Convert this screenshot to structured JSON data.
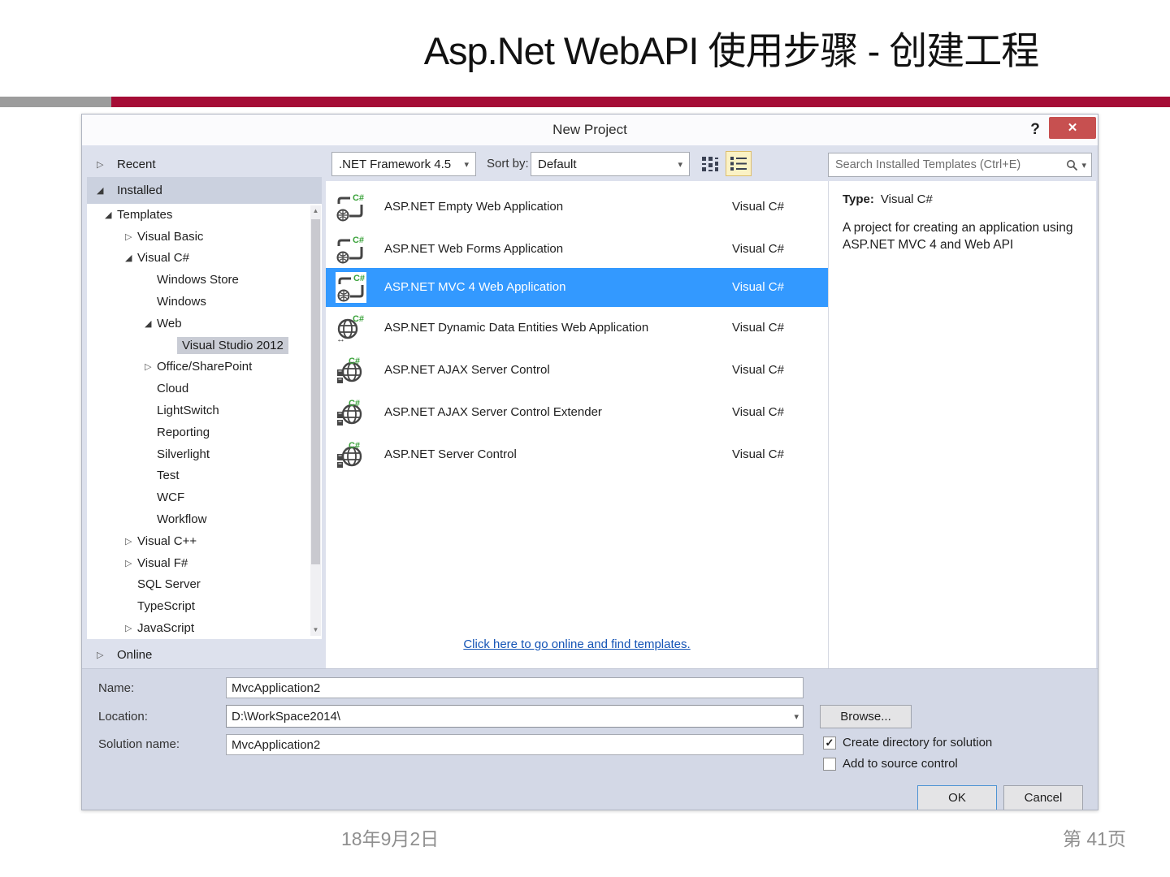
{
  "slide": {
    "title": "Asp.Net WebAPI 使用步骤 - 创建工程",
    "footer_date": "18年9月2日",
    "footer_page": "第 41页"
  },
  "dialog": {
    "title": "New Project",
    "help_label": "?",
    "close_glyph": "✕",
    "toolbar": {
      "framework_value": ".NET Framework 4.5",
      "sort_by_label": "Sort by:",
      "sort_value": "Default"
    },
    "search": {
      "placeholder": "Search Installed Templates (Ctrl+E)"
    },
    "nav": {
      "recent_label": "Recent",
      "installed_label": "Installed",
      "online_label": "Online",
      "tree": [
        {
          "label": "Templates",
          "state": "expanded"
        },
        {
          "label": "Visual Basic",
          "state": "collapsed"
        },
        {
          "label": "Visual C#",
          "state": "expanded"
        },
        {
          "label": "Windows Store",
          "state": "none"
        },
        {
          "label": "Windows",
          "state": "none"
        },
        {
          "label": "Web",
          "state": "expanded"
        },
        {
          "label": "Visual Studio 2012",
          "state": "none",
          "selected": true
        },
        {
          "label": "Office/SharePoint",
          "state": "collapsed"
        },
        {
          "label": "Cloud",
          "state": "none"
        },
        {
          "label": "LightSwitch",
          "state": "none"
        },
        {
          "label": "Reporting",
          "state": "none"
        },
        {
          "label": "Silverlight",
          "state": "none"
        },
        {
          "label": "Test",
          "state": "none"
        },
        {
          "label": "WCF",
          "state": "none"
        },
        {
          "label": "Workflow",
          "state": "none"
        },
        {
          "label": "Visual C++",
          "state": "collapsed"
        },
        {
          "label": "Visual F#",
          "state": "collapsed"
        },
        {
          "label": "SQL Server",
          "state": "none"
        },
        {
          "label": "TypeScript",
          "state": "none"
        },
        {
          "label": "JavaScript",
          "state": "collapsed"
        }
      ]
    },
    "templates": {
      "items": [
        {
          "name": "ASP.NET Empty Web Application",
          "language": "Visual C#"
        },
        {
          "name": "ASP.NET Web Forms Application",
          "language": "Visual C#"
        },
        {
          "name": "ASP.NET MVC 4 Web Application",
          "language": "Visual C#",
          "selected": true
        },
        {
          "name": "ASP.NET Dynamic Data Entities Web Application",
          "language": "Visual C#"
        },
        {
          "name": "ASP.NET AJAX Server Control",
          "language": "Visual C#"
        },
        {
          "name": "ASP.NET AJAX Server Control Extender",
          "language": "Visual C#"
        },
        {
          "name": "ASP.NET Server Control",
          "language": "Visual C#"
        }
      ],
      "online_link": "Click here to go online and find templates."
    },
    "info": {
      "type_label": "Type:",
      "type_value": "Visual C#",
      "description": "A project for creating an application using ASP.NET MVC 4 and Web API"
    },
    "form": {
      "name_label": "Name:",
      "name_value": "MvcApplication2",
      "location_label": "Location:",
      "location_value": "D:\\WorkSpace2014\\",
      "solution_label": "Solution name:",
      "solution_value": "MvcApplication2",
      "browse_button": "Browse...",
      "create_dir_label": "Create directory for solution",
      "create_dir_checked": true,
      "source_control_label": "Add to source control",
      "source_control_checked": false,
      "ok_button": "OK",
      "cancel_button": "Cancel"
    },
    "colors": {
      "accent_red": "#A50D36",
      "accent_gray": "#9C9C9C",
      "selection_blue": "#3399FF",
      "close_red": "#C75050",
      "link_blue": "#1353B5"
    }
  }
}
